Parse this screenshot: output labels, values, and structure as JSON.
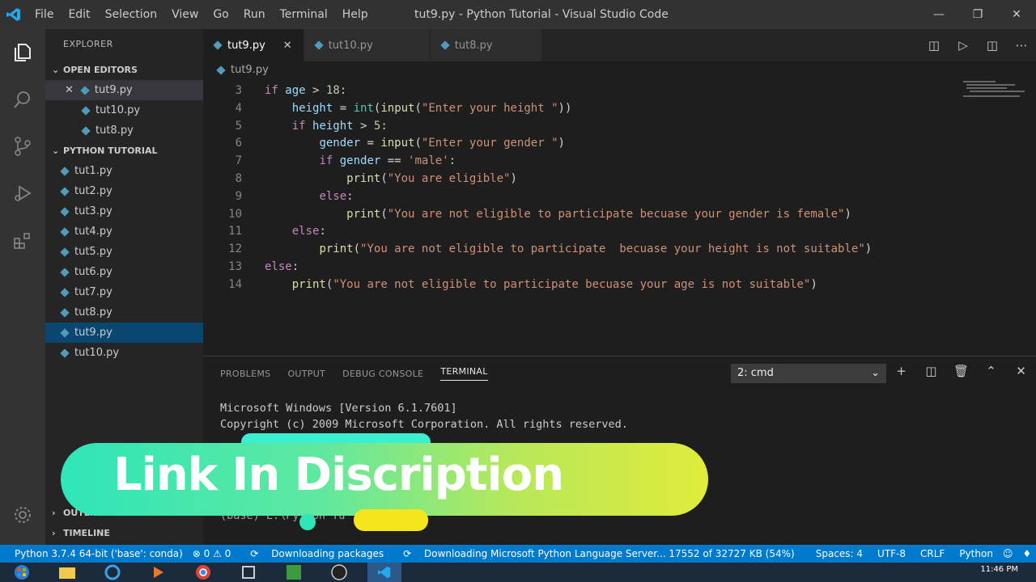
{
  "titlebar": {
    "menus": [
      "File",
      "Edit",
      "Selection",
      "View",
      "Go",
      "Run",
      "Terminal",
      "Help"
    ],
    "title": "tut9.py - Python Tutorial - Visual Studio Code"
  },
  "sidebar": {
    "title": "EXPLORER",
    "open_editors_label": "OPEN EDITORS",
    "open_editors": [
      "tut9.py",
      "tut10.py",
      "tut8.py"
    ],
    "project_label": "PYTHON TUTORIAL",
    "files": [
      "tut1.py",
      "tut2.py",
      "tut3.py",
      "tut4.py",
      "tut5.py",
      "tut6.py",
      "tut7.py",
      "tut8.py",
      "tut9.py",
      "tut10.py"
    ],
    "outline_label": "OUTLINE",
    "timeline_label": "TIMELINE"
  },
  "editor": {
    "tabs": [
      "tut9.py",
      "tut10.py",
      "tut8.py"
    ],
    "breadcrumb": "tut9.py",
    "line_numbers": [
      "3",
      "4",
      "5",
      "6",
      "7",
      "8",
      "9",
      "10",
      "11",
      "12",
      "13",
      "14"
    ]
  },
  "panel": {
    "tabs": [
      "PROBLEMS",
      "OUTPUT",
      "DEBUG CONSOLE",
      "TERMINAL"
    ],
    "terminal_select": "2: cmd",
    "lines": [
      "Microsoft Windows [Version 6.1.7601]",
      "Copyright (c) 2009 Microsoft Corporation.  All rights reserved.",
      "(base) E:\\Python Tu"
    ]
  },
  "statusbar": {
    "interpreter": "Python 3.7.4 64-bit ('base': conda)",
    "problems": "⊗ 0 ⚠ 0",
    "downloading_packages": "Downloading packages",
    "downloading_server": "Downloading Microsoft Python Language Server... 17552 of 32727 KB (54%)",
    "spaces": "Spaces: 4",
    "encoding": "UTF-8",
    "eol": "CRLF",
    "language": "Python"
  },
  "taskbar": {
    "time": "11:46 PM"
  },
  "banner": {
    "text": "Link In Discription"
  },
  "colors": {
    "accent": "#007acc",
    "selection": "#094771"
  }
}
